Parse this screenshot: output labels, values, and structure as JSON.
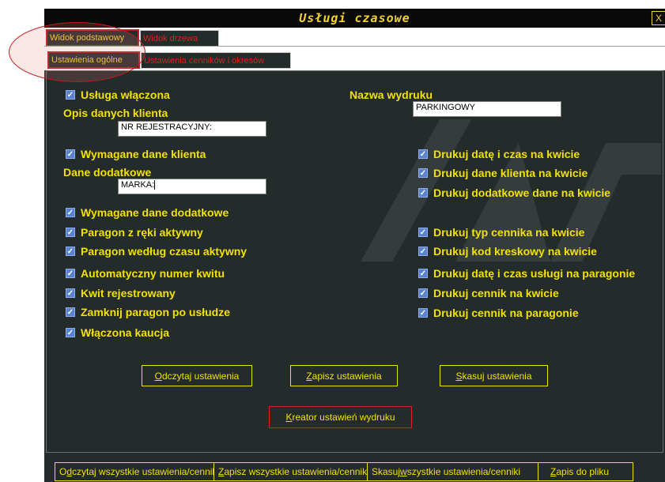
{
  "window": {
    "title": "Usługi czasowe",
    "close_label": "X"
  },
  "tabs_top": [
    {
      "label": "Widok podstawowy",
      "active": true
    },
    {
      "label": "Widok drzewa",
      "active": false
    }
  ],
  "tabs_sub": [
    {
      "label": "Ustawienia ogólne",
      "active": true
    },
    {
      "label": "Ustawienia cenników i okresów",
      "active": false
    }
  ],
  "form": {
    "left_checks": {
      "usluga_wlaczona": "Usługa włączona",
      "wymagane_dane_klienta": "Wymagane dane klienta",
      "wymagane_dane_dodatkowe": "Wymagane dane dodatkowe",
      "paragon_z_reki": "Paragon z ręki aktywny",
      "paragon_wg_czasu": "Paragon według czasu aktywny",
      "auto_numer": "Automatyczny numer kwitu",
      "kwit_rejestrowany": "Kwit rejestrowany",
      "zamknij_paragon": "Zamknij paragon po usłudze",
      "wlaczona_kaucja": "Włączona kaucja"
    },
    "opis_label": "Opis danych klienta",
    "opis_value": "NR REJESTRACYJNY:",
    "dodatkowe_label": "Dane dodatkowe",
    "dodatkowe_value": "MARKA:",
    "nazwa_wydruku_label": "Nazwa wydruku",
    "nazwa_wydruku_value": "PARKINGOWY",
    "right_checks": {
      "drukuj_date": "Drukuj datę i czas na kwicie",
      "drukuj_dane_klienta": "Drukuj dane klienta na kwicie",
      "drukuj_dodatkowe": "Drukuj dodatkowe dane na kwicie",
      "drukuj_typ": "Drukuj typ cennika na kwicie",
      "drukuj_kod": "Drukuj kod kreskowy na kwicie",
      "drukuj_date_uslugi": "Drukuj datę i czas usługi na paragonie",
      "drukuj_cennik_kwit": "Drukuj cennik na kwicie",
      "drukuj_cennik_paragon": "Drukuj cennik na paragonie"
    },
    "checkmark": "✓"
  },
  "buttons": {
    "odczytaj": {
      "first": "O",
      "rest": "dczytaj ustawienia"
    },
    "zapisz": {
      "first": "Z",
      "rest": "apisz ustawienia"
    },
    "skasuj": {
      "first": "S",
      "rest": "kasuj ustawienia"
    },
    "kreator": {
      "first": "K",
      "rest": "reator ustawień wydruku"
    }
  },
  "bottom_buttons": {
    "odczytaj_all": {
      "pre": "O",
      "u": "d",
      "rest": "czytaj wszystkie ustawienia/cenniki"
    },
    "zapisz_all": {
      "pre": "",
      "u": "Z",
      "rest": "apisz wszystkie ustawienia/cenniki"
    },
    "skasuj_all": {
      "pre": "Skasuj ",
      "u": "w",
      "rest": "szystkie ustawienia/cenniki"
    },
    "zapis_pliku": {
      "pre": "",
      "u": "Z",
      "rest": "apis do pliku"
    }
  },
  "colors": {
    "accent": "#f2e200",
    "panel": "#232b2b",
    "tab_inactive_text": "#e81e1e",
    "checkbox": "#5b82d0"
  }
}
